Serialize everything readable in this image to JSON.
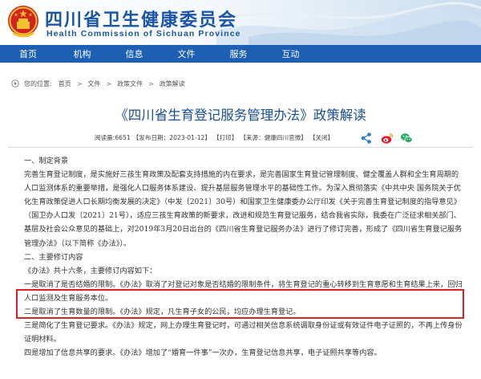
{
  "header": {
    "site_name_cn": "四川省卫生健康委员会",
    "site_name_en": "Health Commission of Sichuan Province"
  },
  "nav": {
    "items": [
      "首页",
      "机构",
      "信息",
      "文件",
      "服务",
      "互动"
    ]
  },
  "breadcrumb": {
    "prefix": "您的位置:",
    "items": [
      "首页",
      "文件",
      "政策文件",
      "政策解读"
    ]
  },
  "article": {
    "title": "《四川省生育登记服务管理办法》政策解读",
    "meta": {
      "views": "阅读量:6651",
      "publish": "【发布日期：2023-01-12】",
      "print": "【打印】",
      "source": "【来源：健康四川官微】",
      "close": "【关闭】"
    },
    "share": {
      "icons": [
        "share-icon",
        "weibo-icon",
        "wechat-icon"
      ],
      "colors": {
        "share": "#2b7bd1",
        "weibo": "#e6162d",
        "wechat": "#2aae67"
      }
    },
    "paragraphs": [
      "一、制定背景",
      "完善生育登记制度，是实施好三孩生育政策及配套支持措施的内在要求，是完善国家生育登记管理制度、健全覆盖人群和全生育周期的人口监测体系的重要举措，是强化人口服务体系建设、提升基层服务管理水平的基础性工作。为深入贯彻落实《中共中央 国务院关于优化生育政策促进人口长期均衡发展的决定》（中发〔2021〕30号）和国家卫生健康委办公厅印发《关于完善生育登记制度的指导意见》（国卫办人口发〔2021〕21号），适应三孩生育政策的新要求，改进和规范生育登记服务，结合我省实际，我委在广泛征求相关部门、基层及社会公众意见的基础上，对2019年3月20日出台的《四川省生育登记服务办法》进行了修订完善，形成了《四川省生育登记服务管理办法》（以下简称《办法》）。",
      "二、主要修订内容",
      "《办法》共十六条，主要修订内容如下：",
      "一是取消了是否结婚的限制。《办法》取消了对登记对象是否结婚的限制条件，将生育登记的重心转移到生育意愿和生育结果上来，回归人口监测及生育服务本位。",
      "二是取消了生育数量的限制。《办法》规定，凡生育子女的公民，均应办理生育登记。",
      "三是简化了生育登记要求。《办法》规定，网上办理生育登记时，可通过相关信息系统调取身份证或有效证件电子证照的，不再上传身份证明材料。",
      "四是增加了信息共享的要求。《办法》增加了“婚育一件事”一次办，生育登记信息共享，电子证照共享等内容。"
    ]
  },
  "colors": {
    "nav_bg": "#1d5fb3",
    "title": "#1a4f96",
    "highlight_border": "#e02020"
  }
}
